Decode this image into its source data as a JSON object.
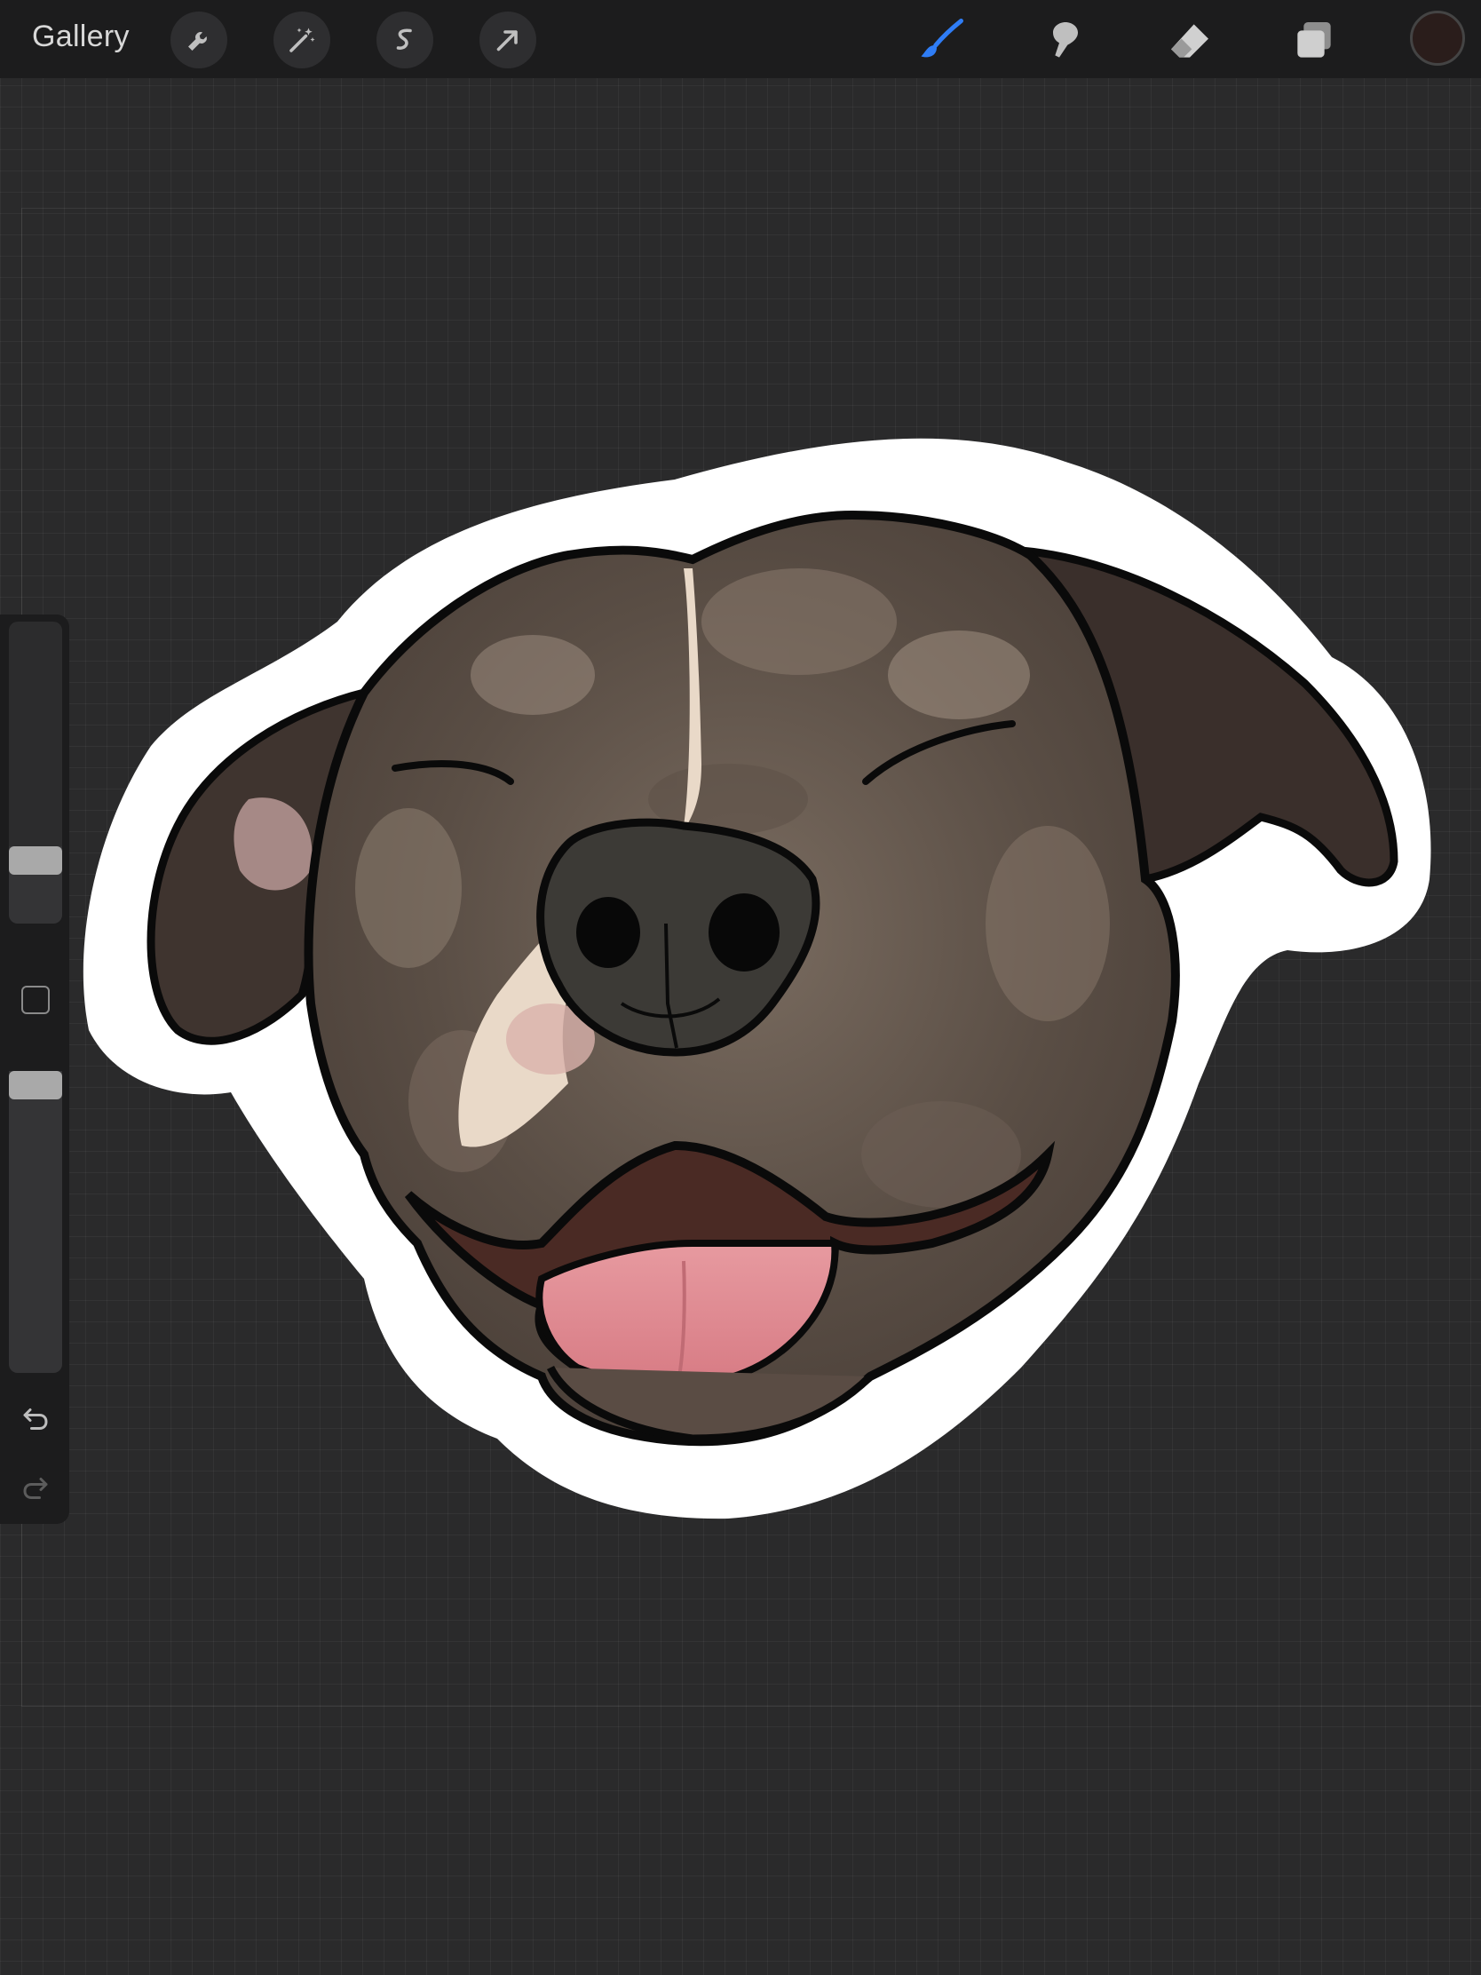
{
  "topbar": {
    "gallery_label": "Gallery",
    "left_tools": [
      "wrench-icon",
      "magic-wand-icon",
      "selection-icon",
      "transform-arrow-icon"
    ],
    "right_tools": [
      "brush-icon",
      "smudge-icon",
      "eraser-icon",
      "layers-icon"
    ],
    "active_tool": "brush-icon",
    "active_color": "#2a1d1b",
    "accent_color": "#2f7df6"
  },
  "sidebar": {
    "brush_size_level": 0.18,
    "opacity_level": 1.0,
    "icons": [
      "modify-square-icon",
      "undo-icon",
      "redo-icon"
    ]
  },
  "canvas": {
    "subject": "dog-sticker-illustration"
  }
}
